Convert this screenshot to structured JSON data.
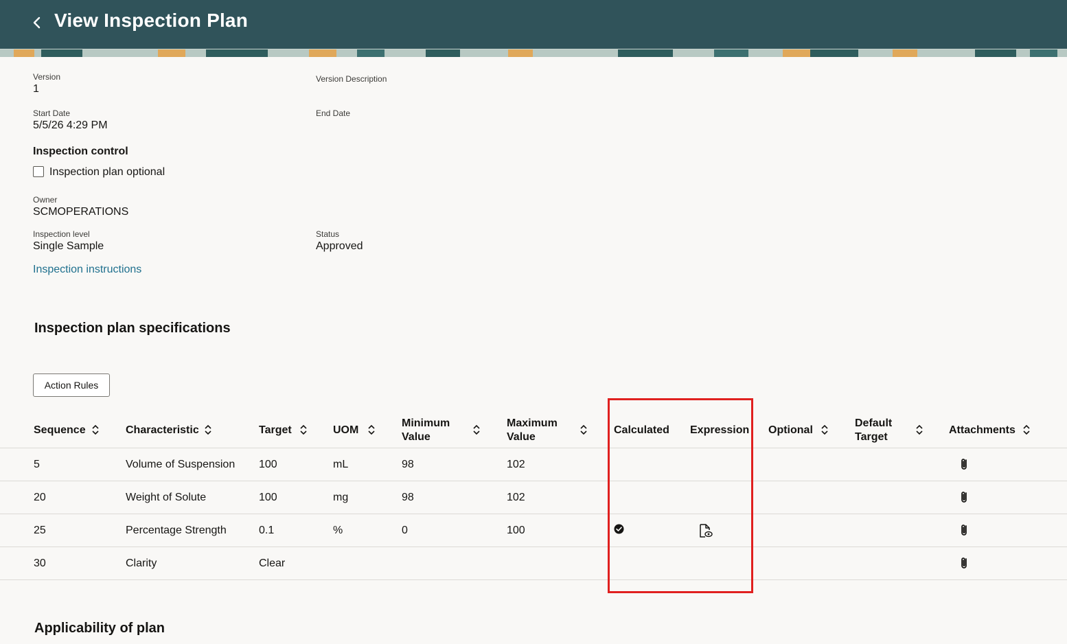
{
  "header": {
    "title": "View Inspection Plan"
  },
  "details": {
    "version_label": "Version",
    "version_value": "1",
    "version_description_label": "Version Description",
    "start_date_label": "Start Date",
    "start_date_value": "5/5/26 4:29 PM",
    "end_date_label": "End Date",
    "inspection_control_heading": "Inspection control",
    "inspection_plan_optional_label": "Inspection plan optional",
    "owner_label": "Owner",
    "owner_value": "SCMOPERATIONS",
    "inspection_level_label": "Inspection level",
    "inspection_level_value": "Single Sample",
    "status_label": "Status",
    "status_value": "Approved",
    "inspection_instructions_link": "Inspection instructions"
  },
  "specifications": {
    "heading": "Inspection plan specifications",
    "action_rules_button": "Action Rules",
    "columns": {
      "sequence": "Sequence",
      "characteristic": "Characteristic",
      "target": "Target",
      "uom": "UOM",
      "min_1": "Minimum",
      "min_2": "Value",
      "max_1": "Maximum",
      "max_2": "Value",
      "calculated": "Calculated",
      "expression": "Expression",
      "optional": "Optional",
      "default_target_1": "Default",
      "default_target_2": "Target",
      "attachments": "Attachments"
    },
    "rows": [
      {
        "sequence": "5",
        "characteristic": "Volume of Suspension",
        "target": "100",
        "uom": "mL",
        "min": "98",
        "max": "102",
        "calculated": false,
        "expression": false
      },
      {
        "sequence": "20",
        "characteristic": "Weight of Solute",
        "target": "100",
        "uom": "mg",
        "min": "98",
        "max": "102",
        "calculated": false,
        "expression": false
      },
      {
        "sequence": "25",
        "characteristic": "Percentage Strength",
        "target": "0.1",
        "uom": "%",
        "min": "0",
        "max": "100",
        "calculated": true,
        "expression": true
      },
      {
        "sequence": "30",
        "characteristic": "Clarity",
        "target": "Clear",
        "uom": "",
        "min": "",
        "max": "",
        "calculated": false,
        "expression": false
      }
    ]
  },
  "applicability": {
    "heading": "Applicability of plan"
  },
  "colors": {
    "header_bg": "#30535a",
    "link": "#1e6f8d",
    "highlight": "#e0201f"
  }
}
